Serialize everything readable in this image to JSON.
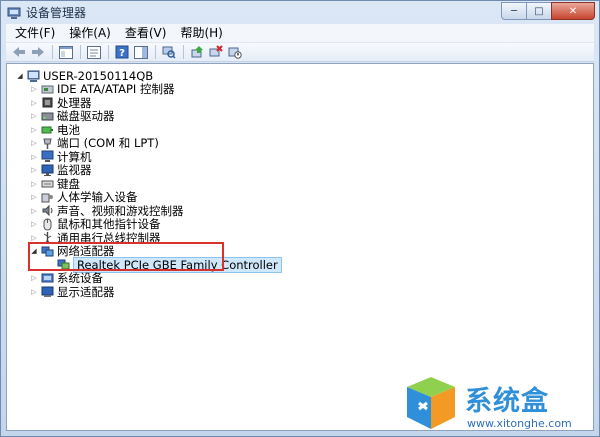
{
  "window": {
    "title": "设备管理器",
    "minimize_label": "─",
    "maximize_label": "□",
    "close_label": "✕"
  },
  "menu": [
    "文件(F)",
    "操作(A)",
    "查看(V)",
    "帮助(H)"
  ],
  "tree": {
    "root": "USER-20150114QB",
    "items": [
      {
        "label": "IDE ATA/ATAPI 控制器",
        "icon": "ide-controller-icon"
      },
      {
        "label": "处理器",
        "icon": "processor-icon"
      },
      {
        "label": "磁盘驱动器",
        "icon": "disk-drive-icon"
      },
      {
        "label": "电池",
        "icon": "battery-icon"
      },
      {
        "label": "端口 (COM 和 LPT)",
        "icon": "port-icon"
      },
      {
        "label": "计算机",
        "icon": "computer-icon"
      },
      {
        "label": "监视器",
        "icon": "monitor-icon"
      },
      {
        "label": "键盘",
        "icon": "keyboard-icon"
      },
      {
        "label": "人体学输入设备",
        "icon": "hid-icon"
      },
      {
        "label": "声音、视频和游戏控制器",
        "icon": "sound-icon"
      },
      {
        "label": "鼠标和其他指针设备",
        "icon": "mouse-icon"
      },
      {
        "label": "通用串行总线控制器",
        "icon": "usb-icon"
      },
      {
        "label": "网络适配器",
        "icon": "network-adapter-icon",
        "expanded": true
      },
      {
        "label": "Realtek PCIe GBE Family Controller",
        "icon": "network-card-icon",
        "child": true,
        "selected": true
      },
      {
        "label": "系统设备",
        "icon": "system-device-icon"
      },
      {
        "label": "显示适配器",
        "icon": "display-adapter-icon"
      }
    ]
  },
  "watermark": {
    "text": "系统盒",
    "url": "www.xitonghe.com"
  },
  "colors": {
    "highlight_border": "#d8322e",
    "selection": "#cfe7fb",
    "watermark": "#2f8fd8"
  }
}
